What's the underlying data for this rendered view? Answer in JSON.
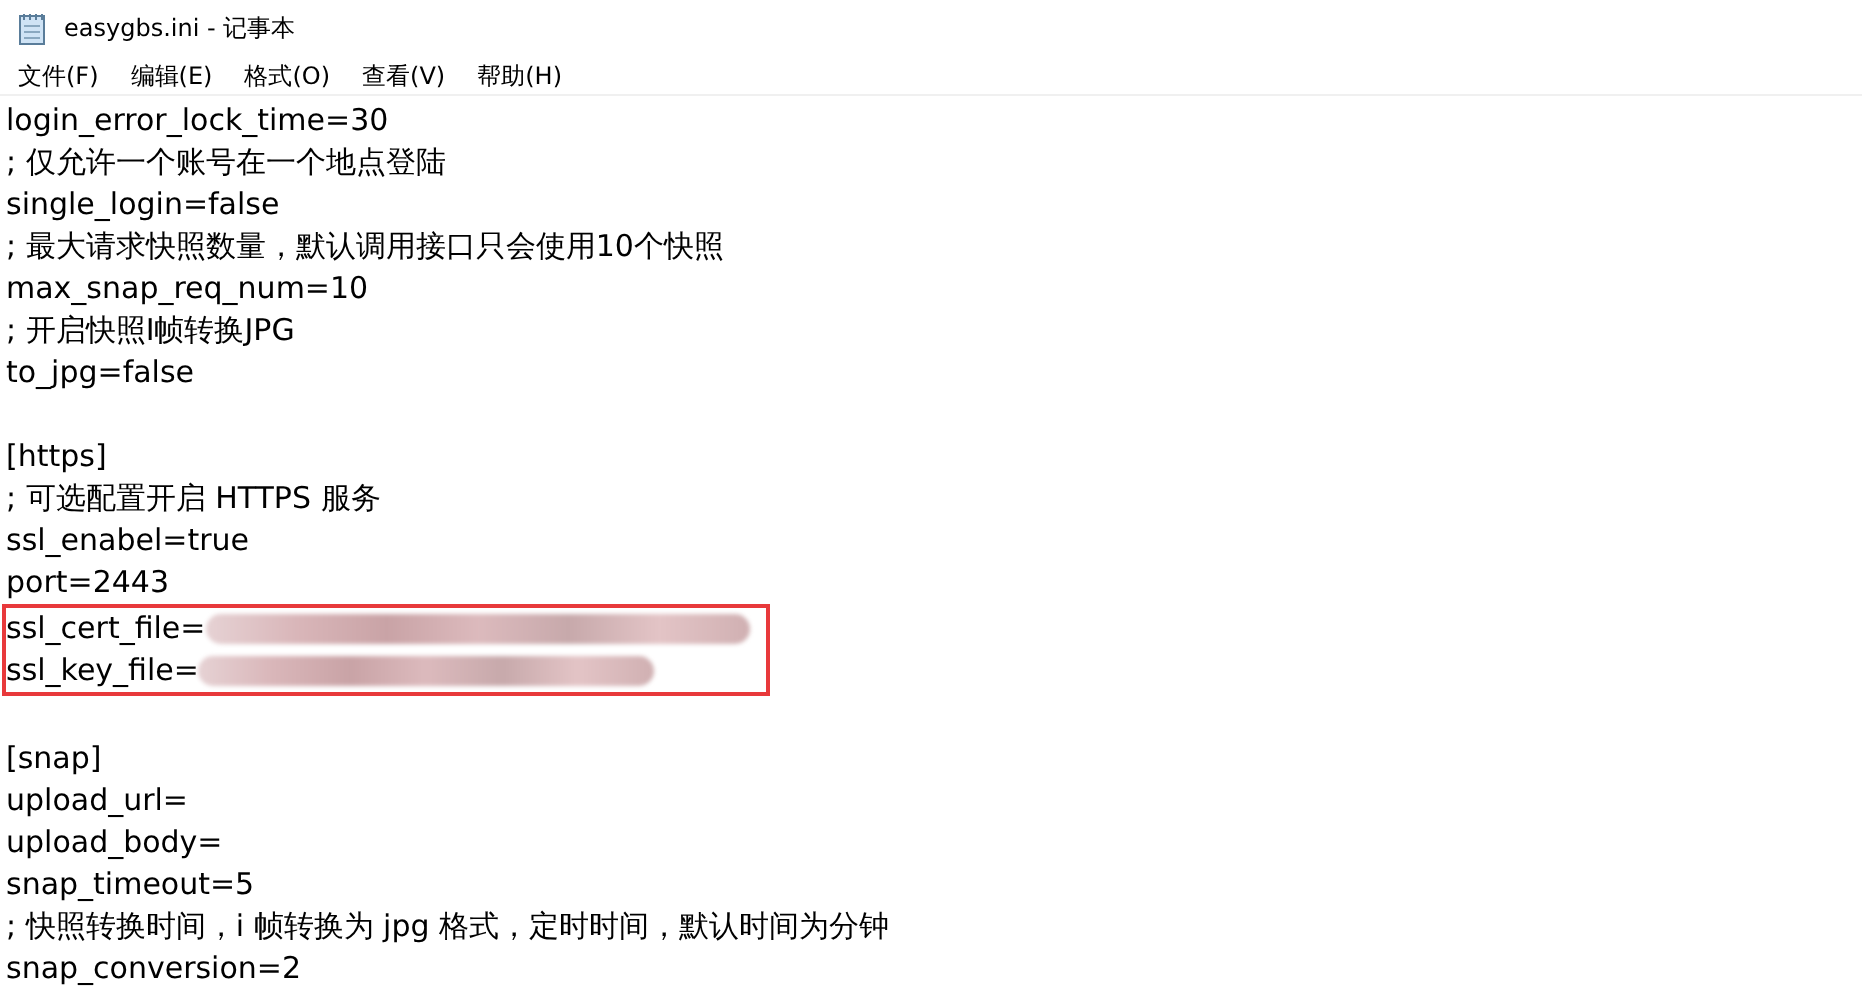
{
  "window": {
    "title": "easygbs.ini - 记事本"
  },
  "menu": [
    "文件(F)",
    "编辑(E)",
    "格式(O)",
    "查看(V)",
    "帮助(H)"
  ],
  "lines": [
    {
      "kind": "text",
      "text": "login_error_lock_time=30"
    },
    {
      "kind": "text",
      "text": "; 仅允许一个账号在一个地点登陆"
    },
    {
      "kind": "text",
      "text": "single_login=false"
    },
    {
      "kind": "text",
      "text": "; 最大请求快照数量，默认调用接口只会使用10个快照"
    },
    {
      "kind": "text",
      "text": "max_snap_req_num=10"
    },
    {
      "kind": "text",
      "text": "; 开启快照I帧转换JPG"
    },
    {
      "kind": "text",
      "text": "to_jpg=false"
    },
    {
      "kind": "blank"
    },
    {
      "kind": "text",
      "text": "[https]"
    },
    {
      "kind": "text",
      "text": "; 可选配置开启 HTTPS 服务"
    },
    {
      "kind": "text",
      "text": "ssl_enabel=true"
    },
    {
      "kind": "text",
      "text": "port=2443"
    },
    {
      "kind": "highlight",
      "lines": [
        {
          "kind": "redacted",
          "text": "ssl_cert_file="
        },
        {
          "kind": "redacted",
          "text": "ssl_key_file="
        }
      ]
    },
    {
      "kind": "blank"
    },
    {
      "kind": "text",
      "text": "[snap]"
    },
    {
      "kind": "text",
      "text": "upload_url="
    },
    {
      "kind": "text",
      "text": "upload_body="
    },
    {
      "kind": "text",
      "text": "snap_timeout=5"
    },
    {
      "kind": "text",
      "text": "; 快照转换时间，i 帧转换为 jpg 格式，定时时间，默认时间为分钟"
    },
    {
      "kind": "text",
      "text": "snap_conversion=2"
    }
  ]
}
